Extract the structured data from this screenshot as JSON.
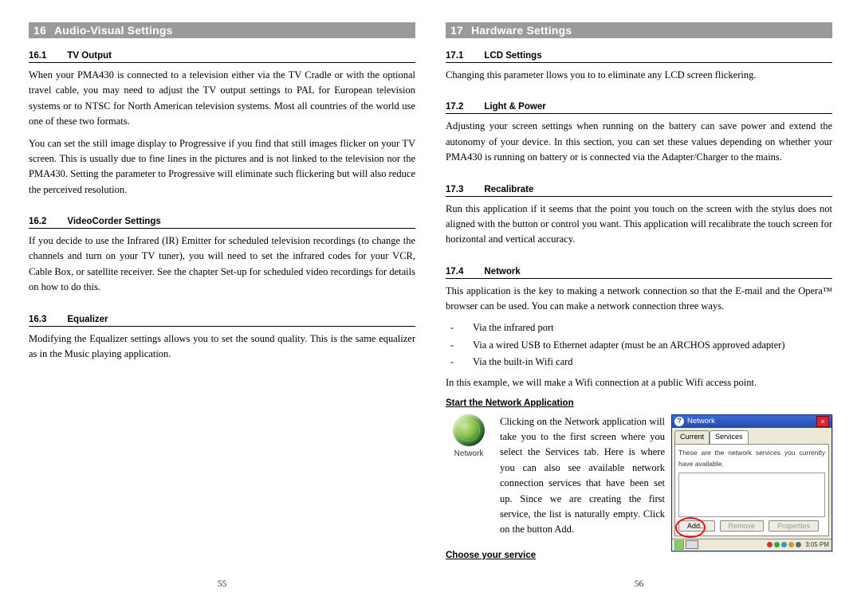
{
  "left": {
    "chapter_num": "16",
    "chapter_title": "Audio-Visual Settings",
    "s1_num": "16.1",
    "s1_title": "TV Output",
    "s1_p1": "When your PMA430 is connected to a television either via the TV Cradle or with the optional travel cable, you may need to adjust the TV output settings to PAL for European television systems or to NTSC for North American television systems. Most all countries of the world use one of these two formats.",
    "s1_p2": "You can set the still image display to Progressive if you find that still images flicker on your TV screen. This is usually due to fine lines in the pictures and is not linked to the television nor the PMA430. Setting the parameter to Progressive will eliminate such flickering but will also reduce the perceived resolution.",
    "s2_num": "16.2",
    "s2_title": "VideoCorder Settings",
    "s2_p1": "If you decide to use the Infrared (IR) Emitter for scheduled television recordings (to change the channels and turn on your TV tuner), you will need to set the infrared codes for your VCR, Cable Box, or satellite receiver. See the chapter Set-up for scheduled video recordings for details on how to do this.",
    "s3_num": "16.3",
    "s3_title": "Equalizer",
    "s3_p1": "Modifying the Equalizer settings allows you to set the sound quality. This is the same equalizer as in the Music playing application.",
    "page_no": "55"
  },
  "right": {
    "chapter_num": "17",
    "chapter_title": "Hardware Settings",
    "s1_num": "17.1",
    "s1_title": "LCD Settings",
    "s1_p1": "Changing this parameter llows you to to eliminate any LCD screen flickering.",
    "s2_num": "17.2",
    "s2_title": "Light & Power",
    "s2_p1": "Adjusting your screen settings when running on the battery can save power and extend the autonomy of your device. In this section, you can set these values depending on whether your PMA430 is running on battery or is connected via the Adapter/Charger to the mains.",
    "s3_num": "17.3",
    "s3_title": "Recalibrate",
    "s3_p1": "Run this application if it seems that the point you touch on the screen with the stylus does not aligned with the button or control you want. This application will recalibrate the touch screen for horizontal and vertical accuracy.",
    "s4_num": "17.4",
    "s4_title": "Network",
    "s4_p1": "This application is the key to making a network connection so that the E-mail and the Opera™ browser can be used. You can make a network connection three ways.",
    "s4_li1": "Via the infrared port",
    "s4_li2": "Via a wired USB to Ethernet adapter (must be an ARCHOS approved adapter)",
    "s4_li3": "Via the built-in Wifi card",
    "s4_p2": "In this example, we will make a Wifi connection at a public Wifi access point.",
    "s4_sub1_title": "Start the Network Application",
    "net_icon_label": "Network",
    "s4_sub1_body": "Clicking on the Network application will take you to the first screen where you select the Services tab. Here is where you can also see available network connection services that have been set up. Since we are creating the first service, the list is naturally empty. Click on the button Add.",
    "s4_sub2_title": "Choose your service",
    "dialog": {
      "title": "Network",
      "tab_current": "Current",
      "tab_services": "Services",
      "hint": "These are the network services you currently have available.",
      "btn_add": "Add...",
      "btn_remove": "Remove",
      "btn_props": "Properties",
      "close_glyph": "×",
      "time": "3:05 PM"
    },
    "page_no": "56"
  }
}
